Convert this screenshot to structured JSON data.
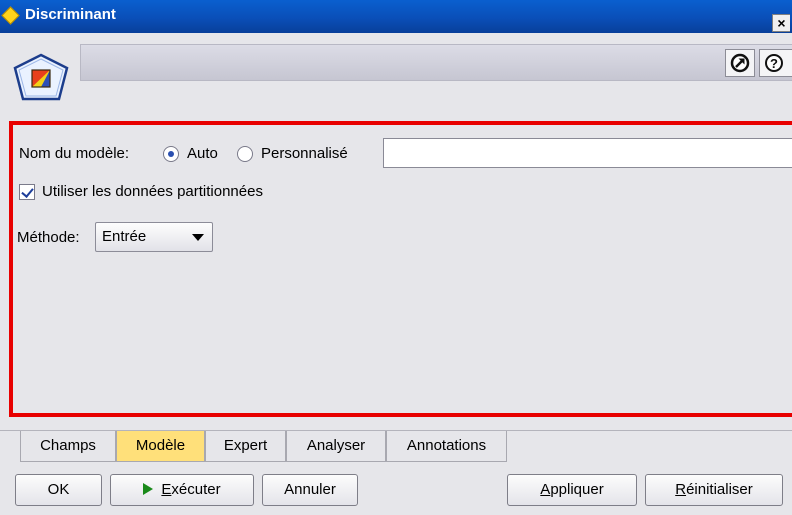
{
  "window": {
    "title": "Discriminant",
    "close_glyph": "×"
  },
  "header": {
    "node_icon": "discriminant-node-icon",
    "goto_icon": "launch-icon",
    "help_glyph": "?"
  },
  "model_name": {
    "label": "Nom du modèle:",
    "options": [
      {
        "label": "Auto",
        "selected": true
      },
      {
        "label": "Personnalisé",
        "selected": false
      }
    ],
    "custom_value": ""
  },
  "partition": {
    "label": "Utiliser les données partitionnées",
    "checked": true
  },
  "method": {
    "label": "Méthode:",
    "selected": "Entrée"
  },
  "tabs": [
    {
      "label": "Champs",
      "active": false
    },
    {
      "label": "Modèle",
      "active": true
    },
    {
      "label": "Expert",
      "active": false
    },
    {
      "label": "Analyser",
      "active": false
    },
    {
      "label": "Annotations",
      "active": false
    }
  ],
  "buttons": {
    "ok": "OK",
    "execute_mnemonic": "E",
    "execute_rest": "xécuter",
    "cancel": "Annuler",
    "apply_mnemonic": "A",
    "apply_rest": "ppliquer",
    "reset_mnemonic": "R",
    "reset_rest": "éinitialiser"
  },
  "colors": {
    "title_bar": "#0a4fb8",
    "highlight_frame": "#e80000",
    "active_tab": "#ffe07a",
    "panel": "#e6e6ea"
  }
}
